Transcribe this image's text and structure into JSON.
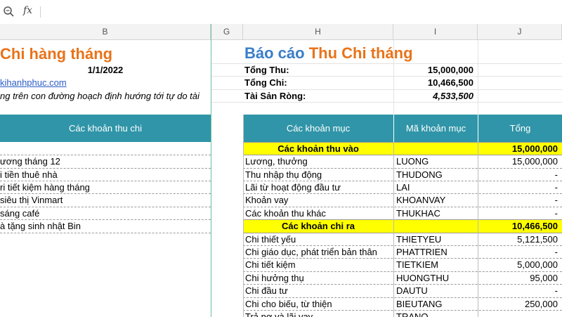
{
  "formula_bar": {
    "zoom_icon": "magnifier-icon",
    "fx_label": "fx",
    "formula": ""
  },
  "columns": [
    "B",
    "G",
    "H",
    "I",
    "J"
  ],
  "left": {
    "title": "Chi hàng tháng",
    "date": "1/1/2022",
    "link": "kihanhphuc.com",
    "motto": "ng trên con đường hoạch định hướng tới tự do tài",
    "header": "Các khoản thu chi",
    "items": [
      "ương tháng 12",
      "i tiền thuê nhà",
      "ri tiết kiệm hàng tháng",
      "siêu thị Vinmart",
      "sáng café",
      "à tặng sinh nhật Bin"
    ]
  },
  "report": {
    "title_part1": "Báo cáo ",
    "title_part2": "Thu Chi tháng",
    "summary": [
      {
        "label": "Tổng Thu:",
        "value": "15,000,000"
      },
      {
        "label": "Tổng Chi:",
        "value": "10,466,500"
      },
      {
        "label": "Tài Sản Ròng:",
        "value": "4,533,500"
      }
    ],
    "table_headers": [
      "Các khoản mục",
      "Mã khoản mục",
      "Tổng"
    ],
    "rows": [
      {
        "type": "group",
        "name": "Các khoản thu vào",
        "code": "",
        "total": "15,000,000"
      },
      {
        "type": "item",
        "name": "Lương, thưởng",
        "code": "LUONG",
        "total": "15,000,000"
      },
      {
        "type": "item",
        "name": "Thu nhập thụ động",
        "code": "THUDONG",
        "total": "-"
      },
      {
        "type": "item",
        "name": "Lãi từ hoạt động đầu tư",
        "code": "LAI",
        "total": "-"
      },
      {
        "type": "item",
        "name": "Khoản vay",
        "code": "KHOANVAY",
        "total": "-"
      },
      {
        "type": "item",
        "name": "Các khoản thu khác",
        "code": "THUKHAC",
        "total": "-"
      },
      {
        "type": "group",
        "name": "Các khoản chi ra",
        "code": "",
        "total": "10,466,500"
      },
      {
        "type": "item",
        "name": "Chi thiết yếu",
        "code": "THIETYEU",
        "total": "5,121,500"
      },
      {
        "type": "item",
        "name": "Chi giáo dục, phát triển bản thân",
        "code": "PHATTRIEN",
        "total": "-"
      },
      {
        "type": "item",
        "name": "Chi tiết kiệm",
        "code": "TIETKIEM",
        "total": "5,000,000"
      },
      {
        "type": "item",
        "name": "Chi hưởng thụ",
        "code": "HUONGTHU",
        "total": "95,000"
      },
      {
        "type": "item",
        "name": "Chi đầu tư",
        "code": "DAUTU",
        "total": "-"
      },
      {
        "type": "item",
        "name": "Chi cho biếu, từ thiện",
        "code": "BIEUTANG",
        "total": "250,000"
      },
      {
        "type": "item",
        "name": "Trả nợ và lãi vay",
        "code": "TRANO",
        "total": ""
      }
    ]
  },
  "colors": {
    "accent_orange": "#e8731a",
    "accent_blue": "#3a7ec8",
    "header_teal": "#3095a8",
    "group_yellow": "#ffff00",
    "freeze_line": "#6cbf9a"
  }
}
